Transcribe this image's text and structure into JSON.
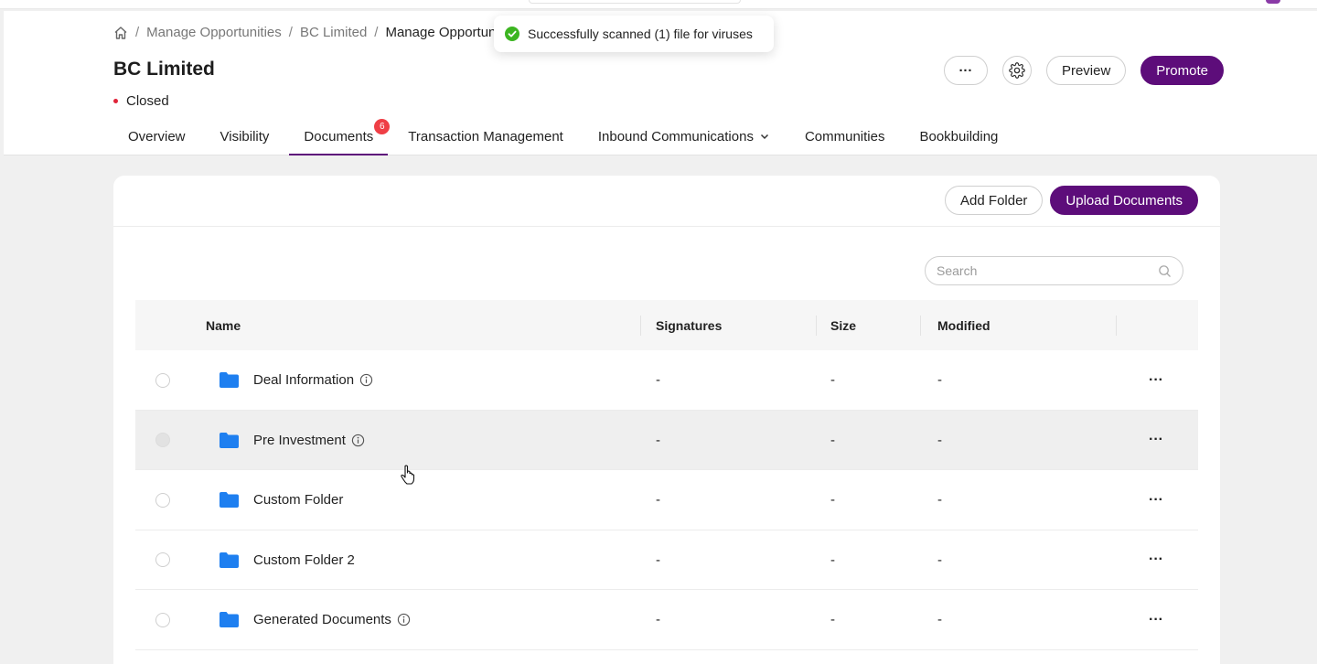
{
  "breadcrumb": {
    "items": [
      "Manage Opportunities",
      "BC Limited",
      "Manage Opportuni"
    ],
    "separator": "/"
  },
  "page": {
    "title": "BC Limited",
    "status": "Closed",
    "status_color": "#e0243a"
  },
  "actions": {
    "more_label": "···",
    "preview_label": "Preview",
    "promote_label": "Promote"
  },
  "tabs": [
    {
      "label": "Overview"
    },
    {
      "label": "Visibility"
    },
    {
      "label": "Documents",
      "badge": "6"
    },
    {
      "label": "Transaction Management"
    },
    {
      "label": "Inbound Communications"
    },
    {
      "label": "Communities"
    },
    {
      "label": "Bookbuilding"
    }
  ],
  "toast": {
    "message": "Successfully scanned (1) file for viruses",
    "color": "#3cb521"
  },
  "documents": {
    "add_folder_label": "Add Folder",
    "upload_label": "Upload Documents",
    "search_placeholder": "Search",
    "columns": [
      "Name",
      "Signatures",
      "Size",
      "Modified"
    ],
    "rows": [
      {
        "name": "Deal Information",
        "signatures": "-",
        "size": "-",
        "modified": "-",
        "more": "···"
      },
      {
        "name": "Pre Investment",
        "signatures": "-",
        "size": "-",
        "modified": "-",
        "more": "···"
      },
      {
        "name": "Custom Folder",
        "signatures": "-",
        "size": "-",
        "modified": "-",
        "more": "···"
      },
      {
        "name": "Custom Folder 2",
        "signatures": "-",
        "size": "-",
        "modified": "-",
        "more": "···"
      },
      {
        "name": "Generated Documents",
        "signatures": "-",
        "size": "-",
        "modified": "-",
        "more": "···"
      }
    ]
  },
  "colors": {
    "primary": "#5d0d7a",
    "folder": "#1e7ff0",
    "badge": "#ef3f46"
  }
}
